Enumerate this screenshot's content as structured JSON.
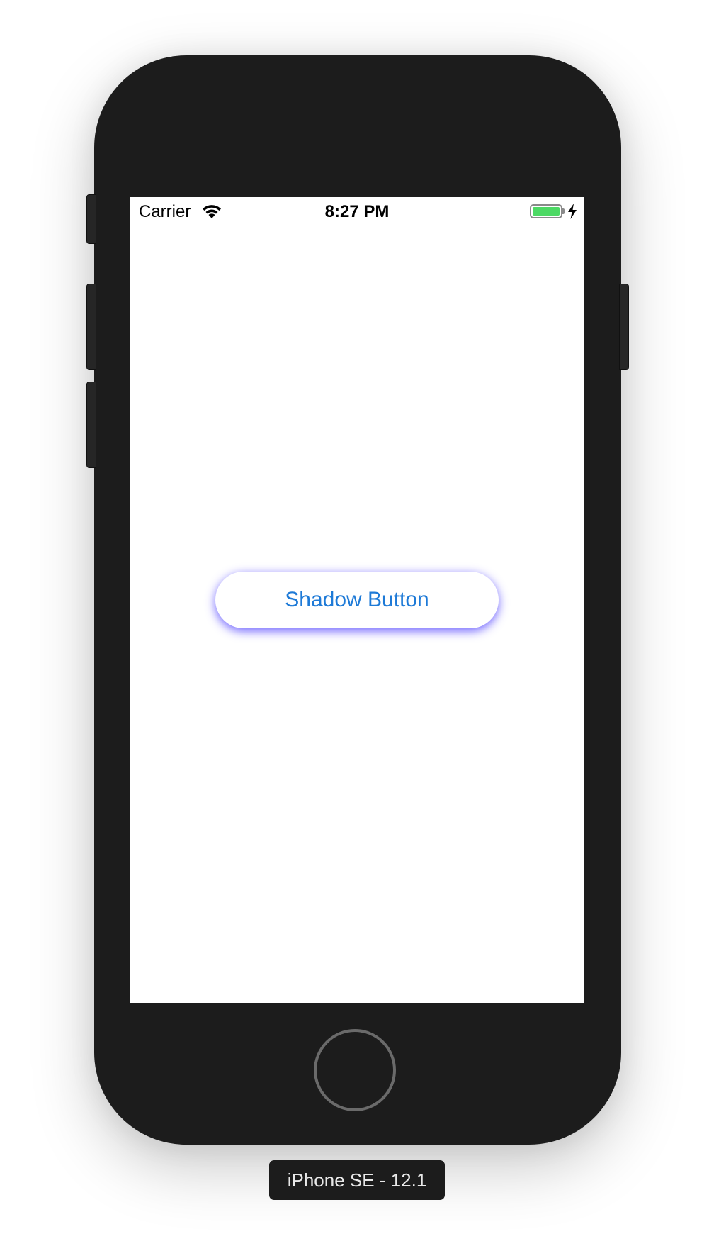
{
  "status_bar": {
    "carrier": "Carrier",
    "time": "8:27 PM",
    "wifi_icon": "wifi-icon",
    "battery_icon": "battery-icon",
    "charging_icon": "charging-bolt-icon",
    "battery_color": "#4cd964",
    "battery_level": 1.0
  },
  "main": {
    "button_label": "Shadow Button",
    "button_text_color": "#1e7ad7",
    "button_shadow_color": "#4030ff"
  },
  "device": {
    "label": "iPhone SE - 12.1",
    "frame_color": "#1c1c1c",
    "home_button_icon": "home-button-icon"
  }
}
